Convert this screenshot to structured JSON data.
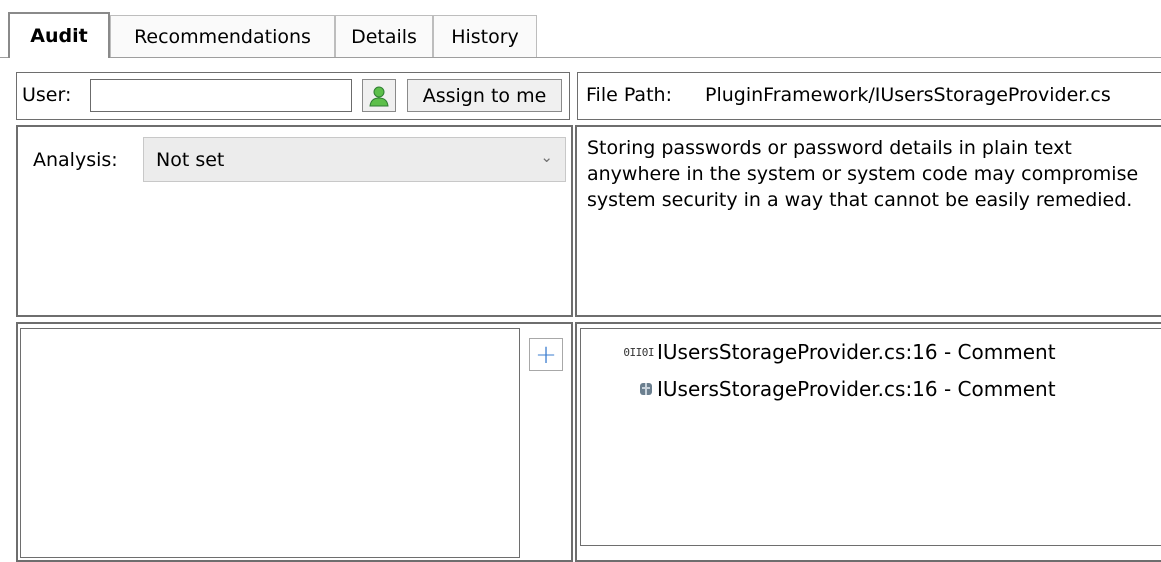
{
  "tabs": [
    {
      "label": "Audit",
      "active": true
    },
    {
      "label": "Recommendations",
      "active": false
    },
    {
      "label": "Details",
      "active": false
    },
    {
      "label": "History",
      "active": false
    }
  ],
  "audit": {
    "user_label": "User:",
    "user_value": "",
    "user_icon": "user-icon",
    "assign_label": "Assign to me",
    "analysis_label": "Analysis:",
    "analysis_value": "Not set",
    "comment_text": "",
    "add_icon": "plus-icon"
  },
  "details": {
    "file_path_label": "File Path:",
    "file_path_value": "PluginFramework/IUsersStorageProvider.cs",
    "description": "Storing passwords or password details in plain text anywhere in the system or system code may compromise system security in a way that cannot be easily remedied."
  },
  "tree": [
    {
      "icon": "binary-icon",
      "icon_text": "0II0I",
      "label": "IUsersStorageProvider.cs:16 - Comment"
    },
    {
      "icon": "file-icon",
      "icon_text": "",
      "label": "IUsersStorageProvider.cs:16 - Comment"
    }
  ],
  "colors": {
    "accent_green": "#3aa54a",
    "plus_blue": "#3b7ccf"
  }
}
